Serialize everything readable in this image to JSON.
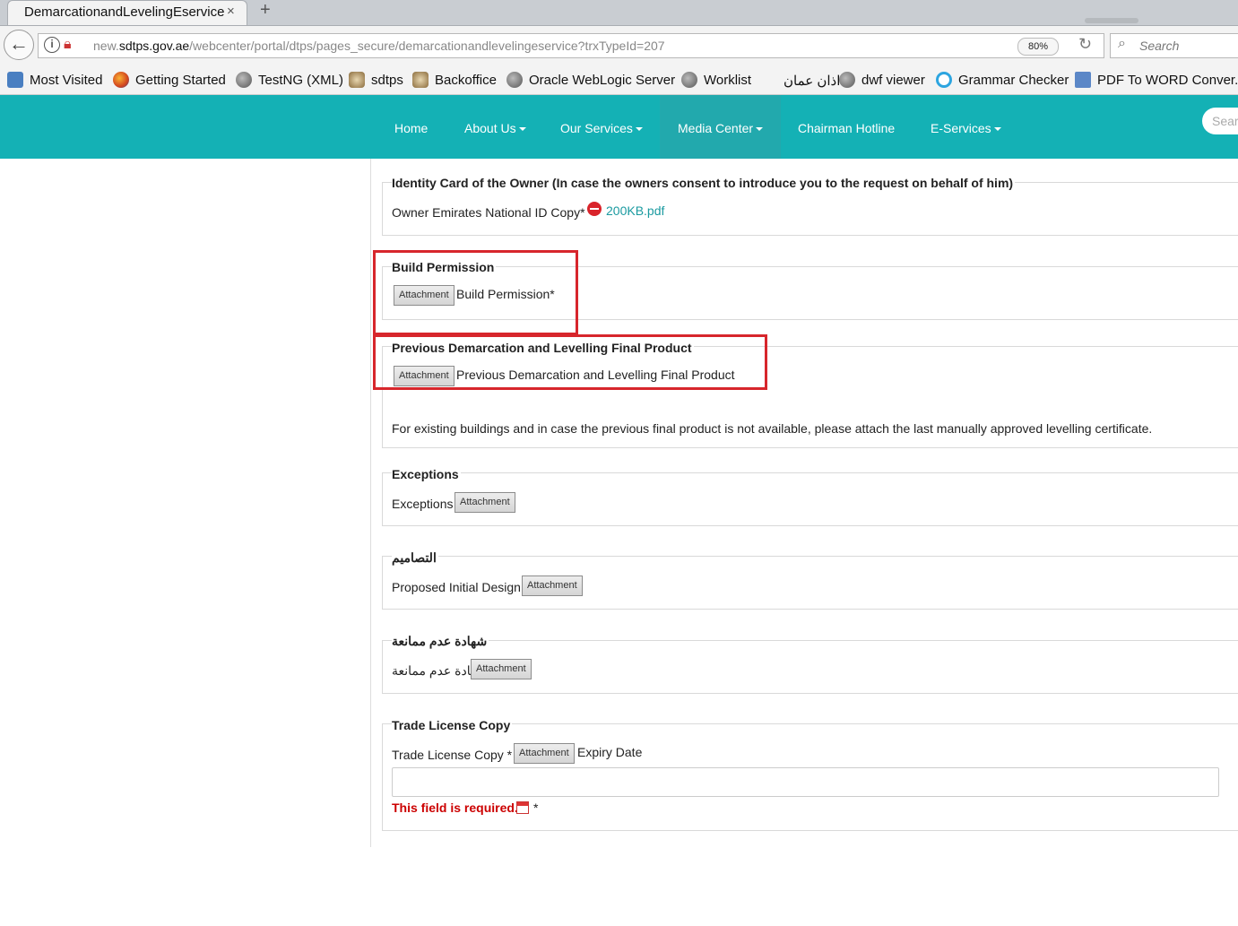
{
  "browser": {
    "tab_title": "DemarcationandLevelingEservice",
    "tab_close": "×",
    "new_tab": "+",
    "url_prefix": "new.",
    "url_domain": "sdtps.gov.ae",
    "url_path": "/webcenter/portal/dtps/pages_secure/demarcationandlevelingeservice?trxTypeId=207",
    "zoom": "80%",
    "search_placeholder": "Search"
  },
  "bookmarks": [
    {
      "label": "Most Visited",
      "icon": "most-visited-icon"
    },
    {
      "label": "Getting Started",
      "icon": "firefox-icon"
    },
    {
      "label": "TestNG (XML)",
      "icon": "globe-icon"
    },
    {
      "label": "sdtps",
      "icon": "emblem-icon"
    },
    {
      "label": "Backoffice",
      "icon": "emblem-icon"
    },
    {
      "label": "Oracle WebLogic Server",
      "icon": "globe-icon"
    },
    {
      "label": "Worklist",
      "icon": "globe-icon"
    },
    {
      "label": "اذان عمان",
      "icon": ""
    },
    {
      "label": "dwf viewer",
      "icon": "globe-icon"
    },
    {
      "label": "Grammar Checker",
      "icon": "grammar-icon"
    },
    {
      "label": "PDF To WORD Conver...",
      "icon": "pdf-icon"
    }
  ],
  "site_nav": {
    "home": "Home",
    "about": "About Us",
    "services": "Our Services",
    "media": "Media Center",
    "hotline": "Chairman Hotline",
    "eservices": "E-Services",
    "search_placeholder": "Sear"
  },
  "form": {
    "identity": {
      "legend": "Identity Card of the Owner (In case the owners consent to introduce you to the request on behalf of him)",
      "label": "Owner Emirates National ID Copy*",
      "file": "200KB.pdf"
    },
    "build_permission": {
      "legend": "Build Permission",
      "button": "Attachment",
      "label": "Build Permission*"
    },
    "previous": {
      "legend": "Previous Demarcation and Levelling Final Product",
      "button": "Attachment",
      "label": "Previous Demarcation and Levelling Final Product",
      "note": "For existing buildings and in case the previous final product is not available, please attach the last manually approved levelling certificate."
    },
    "exceptions": {
      "legend": "Exceptions",
      "label": "Exceptions",
      "button": "Attachment"
    },
    "designs": {
      "legend": "التصاميم",
      "label": "Proposed Initial Design",
      "button": "Attachment"
    },
    "noc": {
      "legend": "شهادة عدم ممانعة",
      "label": "شهادة عدم ممانعة",
      "button": "Attachment"
    },
    "trade_license": {
      "legend": "Trade License Copy",
      "label": "Trade License Copy *",
      "button": "Attachment",
      "expiry_label": "Expiry Date",
      "error": "This field is required.",
      "required_mark": "*"
    }
  },
  "colors": {
    "header_bg": "#14b1b5",
    "highlight_box": "#d7262c",
    "link": "#1a9aa0",
    "error": "#cc0000"
  }
}
